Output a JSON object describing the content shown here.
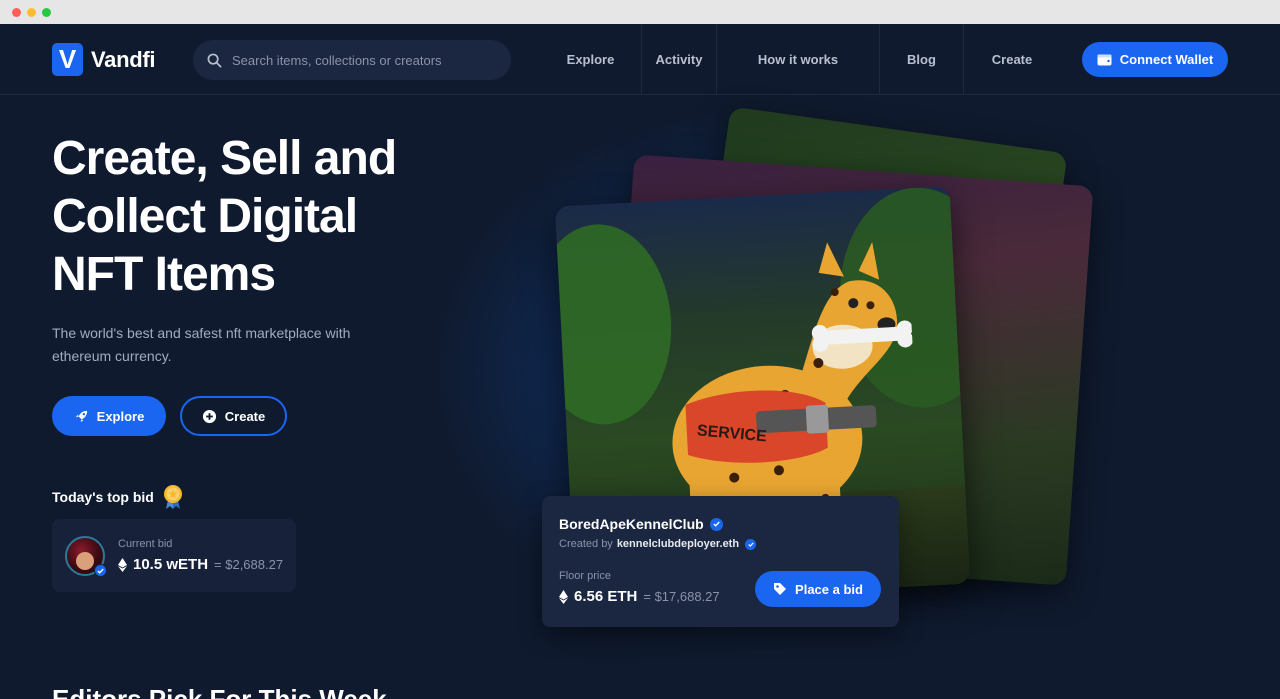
{
  "brand": {
    "logo_letter": "V",
    "name": "Vandfi",
    "accent": "#1a66f0"
  },
  "search": {
    "placeholder": "Search items, collections or creators"
  },
  "nav": {
    "links": [
      "Explore",
      "Activity",
      "How it works",
      "Blog",
      "Create"
    ],
    "connect_label": "Connect Wallet"
  },
  "hero": {
    "title_lines": [
      "Create, Sell and",
      "Collect Digital",
      "NFT Items"
    ],
    "subtitle": "The world's best and safest nft marketplace with ethereum currency.",
    "explore_label": "Explore",
    "create_label": "Create"
  },
  "top_bid": {
    "label": "Today's top bid",
    "current_label": "Current bid",
    "amount": "10.5 wETH",
    "usd": "= $2,688.27"
  },
  "featured": {
    "collection": "BoredApeKennelClub",
    "created_by_label": "Created by",
    "creator": "kennelclubdeployer.eth",
    "floor_label": "Floor price",
    "floor_amount": "6.56 ETH",
    "floor_usd": "= $17,688.27",
    "bid_label": "Place a bid",
    "vest_text": "SERVICE"
  },
  "editors_pick": {
    "title": "Editors Pick For This Week"
  }
}
